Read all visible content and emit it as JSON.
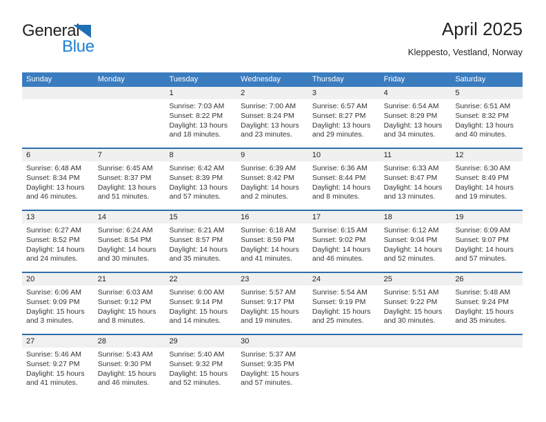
{
  "brand": {
    "name_top": "General",
    "name_bottom": "Blue",
    "triangle_color": "#1f6fb5",
    "blue_text_color": "#1a7fd4"
  },
  "header": {
    "title": "April 2025",
    "subtitle": "Kleppesto, Vestland, Norway"
  },
  "theme": {
    "header_bg": "#3b7cbf",
    "header_text": "#ffffff",
    "daynum_bg": "#f0f0f0",
    "row_separator": "#2d6da8",
    "body_text": "#333333"
  },
  "calendar": {
    "weekday_headers": [
      "Sunday",
      "Monday",
      "Tuesday",
      "Wednesday",
      "Thursday",
      "Friday",
      "Saturday"
    ],
    "weeks": [
      [
        {
          "day": "",
          "lines": []
        },
        {
          "day": "",
          "lines": []
        },
        {
          "day": "1",
          "lines": [
            "Sunrise: 7:03 AM",
            "Sunset: 8:22 PM",
            "Daylight: 13 hours",
            "and 18 minutes."
          ]
        },
        {
          "day": "2",
          "lines": [
            "Sunrise: 7:00 AM",
            "Sunset: 8:24 PM",
            "Daylight: 13 hours",
            "and 23 minutes."
          ]
        },
        {
          "day": "3",
          "lines": [
            "Sunrise: 6:57 AM",
            "Sunset: 8:27 PM",
            "Daylight: 13 hours",
            "and 29 minutes."
          ]
        },
        {
          "day": "4",
          "lines": [
            "Sunrise: 6:54 AM",
            "Sunset: 8:29 PM",
            "Daylight: 13 hours",
            "and 34 minutes."
          ]
        },
        {
          "day": "5",
          "lines": [
            "Sunrise: 6:51 AM",
            "Sunset: 8:32 PM",
            "Daylight: 13 hours",
            "and 40 minutes."
          ]
        }
      ],
      [
        {
          "day": "6",
          "lines": [
            "Sunrise: 6:48 AM",
            "Sunset: 8:34 PM",
            "Daylight: 13 hours",
            "and 46 minutes."
          ]
        },
        {
          "day": "7",
          "lines": [
            "Sunrise: 6:45 AM",
            "Sunset: 8:37 PM",
            "Daylight: 13 hours",
            "and 51 minutes."
          ]
        },
        {
          "day": "8",
          "lines": [
            "Sunrise: 6:42 AM",
            "Sunset: 8:39 PM",
            "Daylight: 13 hours",
            "and 57 minutes."
          ]
        },
        {
          "day": "9",
          "lines": [
            "Sunrise: 6:39 AM",
            "Sunset: 8:42 PM",
            "Daylight: 14 hours",
            "and 2 minutes."
          ]
        },
        {
          "day": "10",
          "lines": [
            "Sunrise: 6:36 AM",
            "Sunset: 8:44 PM",
            "Daylight: 14 hours",
            "and 8 minutes."
          ]
        },
        {
          "day": "11",
          "lines": [
            "Sunrise: 6:33 AM",
            "Sunset: 8:47 PM",
            "Daylight: 14 hours",
            "and 13 minutes."
          ]
        },
        {
          "day": "12",
          "lines": [
            "Sunrise: 6:30 AM",
            "Sunset: 8:49 PM",
            "Daylight: 14 hours",
            "and 19 minutes."
          ]
        }
      ],
      [
        {
          "day": "13",
          "lines": [
            "Sunrise: 6:27 AM",
            "Sunset: 8:52 PM",
            "Daylight: 14 hours",
            "and 24 minutes."
          ]
        },
        {
          "day": "14",
          "lines": [
            "Sunrise: 6:24 AM",
            "Sunset: 8:54 PM",
            "Daylight: 14 hours",
            "and 30 minutes."
          ]
        },
        {
          "day": "15",
          "lines": [
            "Sunrise: 6:21 AM",
            "Sunset: 8:57 PM",
            "Daylight: 14 hours",
            "and 35 minutes."
          ]
        },
        {
          "day": "16",
          "lines": [
            "Sunrise: 6:18 AM",
            "Sunset: 8:59 PM",
            "Daylight: 14 hours",
            "and 41 minutes."
          ]
        },
        {
          "day": "17",
          "lines": [
            "Sunrise: 6:15 AM",
            "Sunset: 9:02 PM",
            "Daylight: 14 hours",
            "and 46 minutes."
          ]
        },
        {
          "day": "18",
          "lines": [
            "Sunrise: 6:12 AM",
            "Sunset: 9:04 PM",
            "Daylight: 14 hours",
            "and 52 minutes."
          ]
        },
        {
          "day": "19",
          "lines": [
            "Sunrise: 6:09 AM",
            "Sunset: 9:07 PM",
            "Daylight: 14 hours",
            "and 57 minutes."
          ]
        }
      ],
      [
        {
          "day": "20",
          "lines": [
            "Sunrise: 6:06 AM",
            "Sunset: 9:09 PM",
            "Daylight: 15 hours",
            "and 3 minutes."
          ]
        },
        {
          "day": "21",
          "lines": [
            "Sunrise: 6:03 AM",
            "Sunset: 9:12 PM",
            "Daylight: 15 hours",
            "and 8 minutes."
          ]
        },
        {
          "day": "22",
          "lines": [
            "Sunrise: 6:00 AM",
            "Sunset: 9:14 PM",
            "Daylight: 15 hours",
            "and 14 minutes."
          ]
        },
        {
          "day": "23",
          "lines": [
            "Sunrise: 5:57 AM",
            "Sunset: 9:17 PM",
            "Daylight: 15 hours",
            "and 19 minutes."
          ]
        },
        {
          "day": "24",
          "lines": [
            "Sunrise: 5:54 AM",
            "Sunset: 9:19 PM",
            "Daylight: 15 hours",
            "and 25 minutes."
          ]
        },
        {
          "day": "25",
          "lines": [
            "Sunrise: 5:51 AM",
            "Sunset: 9:22 PM",
            "Daylight: 15 hours",
            "and 30 minutes."
          ]
        },
        {
          "day": "26",
          "lines": [
            "Sunrise: 5:48 AM",
            "Sunset: 9:24 PM",
            "Daylight: 15 hours",
            "and 35 minutes."
          ]
        }
      ],
      [
        {
          "day": "27",
          "lines": [
            "Sunrise: 5:46 AM",
            "Sunset: 9:27 PM",
            "Daylight: 15 hours",
            "and 41 minutes."
          ]
        },
        {
          "day": "28",
          "lines": [
            "Sunrise: 5:43 AM",
            "Sunset: 9:30 PM",
            "Daylight: 15 hours",
            "and 46 minutes."
          ]
        },
        {
          "day": "29",
          "lines": [
            "Sunrise: 5:40 AM",
            "Sunset: 9:32 PM",
            "Daylight: 15 hours",
            "and 52 minutes."
          ]
        },
        {
          "day": "30",
          "lines": [
            "Sunrise: 5:37 AM",
            "Sunset: 9:35 PM",
            "Daylight: 15 hours",
            "and 57 minutes."
          ]
        },
        {
          "day": "",
          "lines": []
        },
        {
          "day": "",
          "lines": []
        },
        {
          "day": "",
          "lines": []
        }
      ]
    ]
  }
}
